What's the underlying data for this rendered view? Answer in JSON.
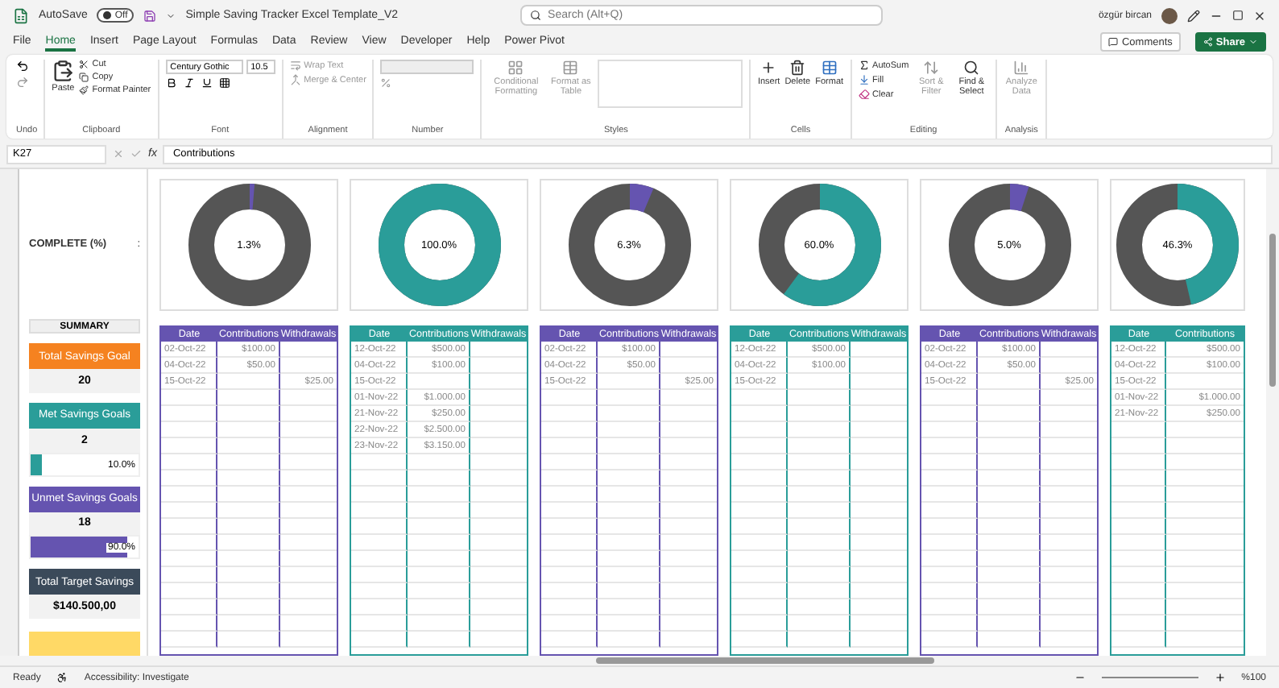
{
  "titlebar": {
    "autosave_label": "AutoSave",
    "autosave": {
      "on": false,
      "text": "Off"
    },
    "filename": "Simple Saving Tracker Excel Template_V2",
    "search": {
      "placeholder": "Search (Alt+Q)"
    },
    "user": "özgür bircan"
  },
  "ribbon_tabs": [
    {
      "label": "File",
      "selected": false
    },
    {
      "label": "Home",
      "selected": true
    },
    {
      "label": "Insert",
      "selected": false
    },
    {
      "label": "Page Layout",
      "selected": false
    },
    {
      "label": "Formulas",
      "selected": false
    },
    {
      "label": "Data",
      "selected": false
    },
    {
      "label": "Review",
      "selected": false
    },
    {
      "label": "View",
      "selected": false
    },
    {
      "label": "Developer",
      "selected": false
    },
    {
      "label": "Help",
      "selected": false
    },
    {
      "label": "Power Pivot",
      "selected": false
    }
  ],
  "comments_button": "Comments",
  "share_button": "Share",
  "ribbon": {
    "undo_group": "Undo",
    "clipboard": {
      "label": "Clipboard",
      "paste": "Paste",
      "cut": "Cut",
      "copy": "Copy",
      "format_painter": "Format Painter"
    },
    "font": {
      "label": "Font",
      "name": "Century Gothic",
      "size": "10.5"
    },
    "alignment": {
      "label": "Alignment",
      "wrap": "Wrap Text",
      "merge": "Merge & Center"
    },
    "number": {
      "label": "Number"
    },
    "styles": {
      "label": "Styles",
      "conditional": "Conditional Formatting",
      "table": "Format as Table"
    },
    "cells": {
      "label": "Cells",
      "insert": "Insert",
      "delete": "Delete",
      "format": "Format"
    },
    "editing": {
      "label": "Editing",
      "autosum": "AutoSum",
      "fill": "Fill",
      "clear": "Clear",
      "sort": "Sort & Filter",
      "find": "Find & Select"
    },
    "analysis": {
      "label": "Analysis",
      "analyze": "Analyze Data"
    }
  },
  "formula_bar": {
    "cell": "K27",
    "fx": "fx",
    "content": "Contributions"
  },
  "sheet": {
    "complete_label": "COMPLETE (%)",
    "colon": ":",
    "summary_title": "SUMMARY",
    "summary": [
      {
        "kind": "label",
        "text": "Total Savings Goal",
        "color": "#f58220"
      },
      {
        "kind": "value",
        "text": "20"
      },
      {
        "kind": "label",
        "text": "Met Savings Goals",
        "color": "#2a9d99"
      },
      {
        "kind": "value",
        "text": "2"
      },
      {
        "kind": "bar",
        "text": "10.0%",
        "level": 0.1,
        "color": "#2a9d99"
      },
      {
        "kind": "label",
        "text": "Unmet Savings Goals",
        "color": "#6554b0"
      },
      {
        "kind": "value",
        "text": "18"
      },
      {
        "kind": "bar",
        "text": "90.0%",
        "level": 0.9,
        "color": "#6554b0"
      },
      {
        "kind": "label",
        "text": "Total Target Savings",
        "color": "#3b4a5a"
      },
      {
        "kind": "value",
        "text": "$140.500,00"
      },
      {
        "kind": "swatch",
        "color": "#ffd966"
      }
    ],
    "goals": [
      {
        "complete": "1.3%",
        "level": 0.013,
        "color": "#6554b0",
        "columns": [
          "Date",
          "Contributions",
          "Withdrawals"
        ],
        "rows": [
          [
            "02-Oct-22",
            "$100.00",
            ""
          ],
          [
            "04-Oct-22",
            "$50.00",
            ""
          ],
          [
            "15-Oct-22",
            "",
            "$25.00"
          ]
        ]
      },
      {
        "complete": "100.0%",
        "level": 1,
        "color": "#2a9d99",
        "columns": [
          "Date",
          "Contributions",
          "Withdrawals"
        ],
        "rows": [
          [
            "12-Oct-22",
            "$500.00",
            ""
          ],
          [
            "04-Oct-22",
            "$100.00",
            ""
          ],
          [
            "15-Oct-22",
            "",
            ""
          ],
          [
            "01-Nov-22",
            "$1.000.00",
            ""
          ],
          [
            "21-Nov-22",
            "$250.00",
            ""
          ],
          [
            "22-Nov-22",
            "$2.500.00",
            ""
          ],
          [
            "23-Nov-22",
            "$3.150.00",
            ""
          ]
        ]
      },
      {
        "complete": "6.3%",
        "level": 0.063,
        "color": "#6554b0",
        "columns": [
          "Date",
          "Contributions",
          "Withdrawals"
        ],
        "rows": [
          [
            "02-Oct-22",
            "$100.00",
            ""
          ],
          [
            "04-Oct-22",
            "$50.00",
            ""
          ],
          [
            "15-Oct-22",
            "",
            "$25.00"
          ]
        ]
      },
      {
        "complete": "60.0%",
        "level": 0.6,
        "color": "#2a9d99",
        "columns": [
          "Date",
          "Contributions",
          "Withdrawals"
        ],
        "rows": [
          [
            "12-Oct-22",
            "$500.00",
            ""
          ],
          [
            "04-Oct-22",
            "$100.00",
            ""
          ],
          [
            "15-Oct-22",
            "",
            ""
          ]
        ]
      },
      {
        "complete": "5.0%",
        "level": 0.05,
        "color": "#6554b0",
        "columns": [
          "Date",
          "Contributions",
          "Withdrawals"
        ],
        "rows": [
          [
            "02-Oct-22",
            "$100.00",
            ""
          ],
          [
            "04-Oct-22",
            "$50.00",
            ""
          ],
          [
            "15-Oct-22",
            "",
            "$25.00"
          ]
        ]
      },
      {
        "complete": "46.3%",
        "level": 0.463,
        "color": "#2a9d99",
        "columns": [
          "Date",
          "Contributions"
        ],
        "rows": [
          [
            "12-Oct-22",
            "$500.00"
          ],
          [
            "04-Oct-22",
            "$100.00"
          ],
          [
            "15-Oct-22",
            ""
          ],
          [
            "01-Nov-22",
            "$1.000.00"
          ],
          [
            "21-Nov-22",
            "$250.00"
          ]
        ]
      }
    ]
  },
  "status_bar": {
    "ready": "Ready",
    "accessibility": "Accessibility: Investigate",
    "zoom": "%100"
  }
}
